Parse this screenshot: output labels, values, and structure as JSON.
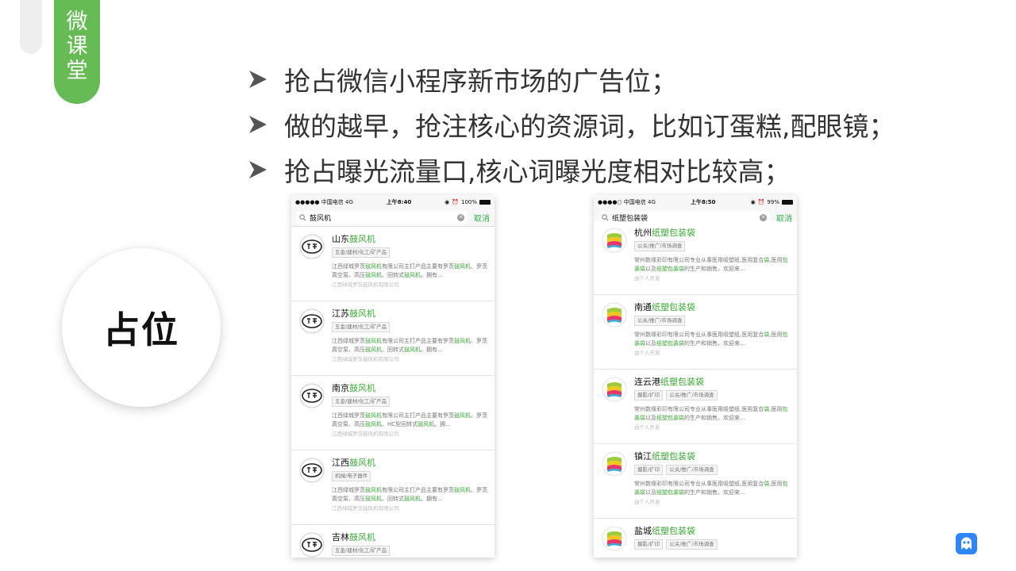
{
  "side_tag": {
    "label": "微\n课\n堂"
  },
  "circle_label": "占位",
  "bullets": [
    "抢占微信小程序新市场的广告位；",
    "做的越早，抢注核心的资源词，比如订蛋糕,配眼镜；",
    "抢占曝光流量口,核心词曝光度相对比较高；"
  ],
  "colors": {
    "accent_green": "#66bb55",
    "highlight_green": "#3aaa35",
    "corner_logo_blue": "#2f86f6"
  },
  "phones": [
    {
      "status": {
        "carrier": "●●●●● 中国电信",
        "network": "4G",
        "time": "上午8:40",
        "battery": "100%"
      },
      "search": {
        "query": "鼓风机",
        "cancel": "取消"
      },
      "logo_icon": "jiangsheng-logo-icon",
      "items": [
        {
          "name_prefix": "山东",
          "name_hl": "鼓风机",
          "tags": [
            "五金/建材/化工/矿产品"
          ],
          "desc": [
            [
              "江西绿城罗茨",
              ""
            ],
            [
              "鼓风机",
              "hl"
            ],
            [
              "有限公司主打产品主要有罗茨",
              ""
            ],
            [
              "鼓风机",
              "hl"
            ],
            [
              "、罗茨真空泵、高压",
              ""
            ],
            [
              "鼓风机",
              "hl"
            ],
            [
              "、回转式",
              ""
            ],
            [
              "鼓风机",
              "hl"
            ],
            [
              "。拥有…",
              ""
            ]
          ],
          "owner": "江西绿城罗茨鼓风机有限公司"
        },
        {
          "name_prefix": "江苏",
          "name_hl": "鼓风机",
          "tags": [
            "五金/建材/化工/矿产品"
          ],
          "desc": [
            [
              "江西绿城罗茨",
              ""
            ],
            [
              "鼓风机",
              "hl"
            ],
            [
              "有限公司主打产品主要有罗茨",
              ""
            ],
            [
              "鼓风机",
              "hl"
            ],
            [
              "、罗茨真空泵、高压",
              ""
            ],
            [
              "鼓风机",
              "hl"
            ],
            [
              "、回转式",
              ""
            ],
            [
              "鼓风机",
              "hl"
            ],
            [
              "。拥有…",
              ""
            ]
          ],
          "owner": "江西绿城罗茨鼓风机有限公司"
        },
        {
          "name_prefix": "南京",
          "name_hl": "鼓风机",
          "tags": [
            "五金/建材/化工/矿产品"
          ],
          "desc": [
            [
              "江西绿城罗茨",
              ""
            ],
            [
              "鼓风机",
              "hl"
            ],
            [
              "有限公司主打产品主要有罗茨",
              ""
            ],
            [
              "鼓风机",
              "hl"
            ],
            [
              "、罗茨真空泵、高压",
              ""
            ],
            [
              "鼓风机",
              "hl"
            ],
            [
              "、HC型回转式",
              ""
            ],
            [
              "鼓风机",
              "hl"
            ],
            [
              "。拥…",
              ""
            ]
          ],
          "owner": "江西绿城罗茨鼓风机有限公司"
        },
        {
          "name_prefix": "江西",
          "name_hl": "鼓风机",
          "tags": [
            "机械/电子器件"
          ],
          "desc": [
            [
              "江西绿城罗茨",
              ""
            ],
            [
              "鼓风机",
              "hl"
            ],
            [
              "有限公司主打产品主要有罗茨",
              ""
            ],
            [
              "鼓风机",
              "hl"
            ],
            [
              "、罗茨真空泵、高压",
              ""
            ],
            [
              "鼓风机",
              "hl"
            ],
            [
              "、回转式",
              ""
            ],
            [
              "鼓风机",
              "hl"
            ],
            [
              "。拥有…",
              ""
            ]
          ],
          "owner": "江西绿城罗茨鼓风机有限公司"
        },
        {
          "name_prefix": "吉林",
          "name_hl": "鼓风机",
          "tags": [
            "五金/建材/化工/矿产品"
          ],
          "desc": [],
          "owner": ""
        }
      ]
    },
    {
      "status": {
        "carrier": "●●●●○ 中国电信",
        "network": "4G",
        "time": "上午8:50",
        "battery": "99%"
      },
      "search": {
        "query": "纸塑包装袋",
        "cancel": "取消"
      },
      "logo_icon": "colorful-bag-logo-icon",
      "items": [
        {
          "name_prefix": "杭州",
          "name_hl": "纸塑包装袋",
          "tags": [
            "公关/推广/市场调查"
          ],
          "desc": [
            [
              "常州数缘彩印有限公司专业从事医用吸塑纸,医用复合",
              ""
            ],
            [
              "袋",
              "hl"
            ],
            [
              ",医用",
              ""
            ],
            [
              "包装袋",
              "hl"
            ],
            [
              "以及",
              ""
            ],
            [
              "纸塑包装袋",
              "hl"
            ],
            [
              "的生产和销售。欢迎来…",
              ""
            ]
          ],
          "owner": "由个人开发"
        },
        {
          "name_prefix": "南通",
          "name_hl": "纸塑包装袋",
          "tags": [
            "公关/推广/市场调查"
          ],
          "desc": [
            [
              "常州数缘彩印有限公司专业从事医用吸塑纸,医用复合",
              ""
            ],
            [
              "袋",
              "hl"
            ],
            [
              ",医用",
              ""
            ],
            [
              "包装袋",
              "hl"
            ],
            [
              "以及",
              ""
            ],
            [
              "纸塑包装袋",
              "hl"
            ],
            [
              "的生产和销售。欢迎来…",
              ""
            ]
          ],
          "owner": "由个人开发"
        },
        {
          "name_prefix": "连云港",
          "name_hl": "纸塑包装袋",
          "tags": [
            "摄影/扩印",
            "公关/推广/市场调查"
          ],
          "desc": [
            [
              "常州数缘彩印有限公司专业从事医用吸塑纸,医用复合",
              ""
            ],
            [
              "袋",
              "hl"
            ],
            [
              ",医用",
              ""
            ],
            [
              "包装袋",
              "hl"
            ],
            [
              "以及",
              ""
            ],
            [
              "纸塑包装袋",
              "hl"
            ],
            [
              "的生产和销售。欢迎来…",
              ""
            ]
          ],
          "owner": "由个人开发"
        },
        {
          "name_prefix": "镇江",
          "name_hl": "纸塑包装袋",
          "tags": [
            "摄影/扩印",
            "公关/推广/市场调查"
          ],
          "desc": [
            [
              "常州数缘彩印有限公司专业从事医用吸塑纸,医用复合",
              ""
            ],
            [
              "袋",
              "hl"
            ],
            [
              ",医用",
              ""
            ],
            [
              "包装袋",
              "hl"
            ],
            [
              "以及",
              ""
            ],
            [
              "纸塑包装袋",
              "hl"
            ],
            [
              "的生产和销售。欢迎来…",
              ""
            ]
          ],
          "owner": "由个人开发"
        },
        {
          "name_prefix": "盐城",
          "name_hl": "纸塑包装袋",
          "tags": [
            "摄影/扩印",
            "公关/推广/市场调查"
          ],
          "desc": [],
          "owner": ""
        }
      ]
    }
  ]
}
